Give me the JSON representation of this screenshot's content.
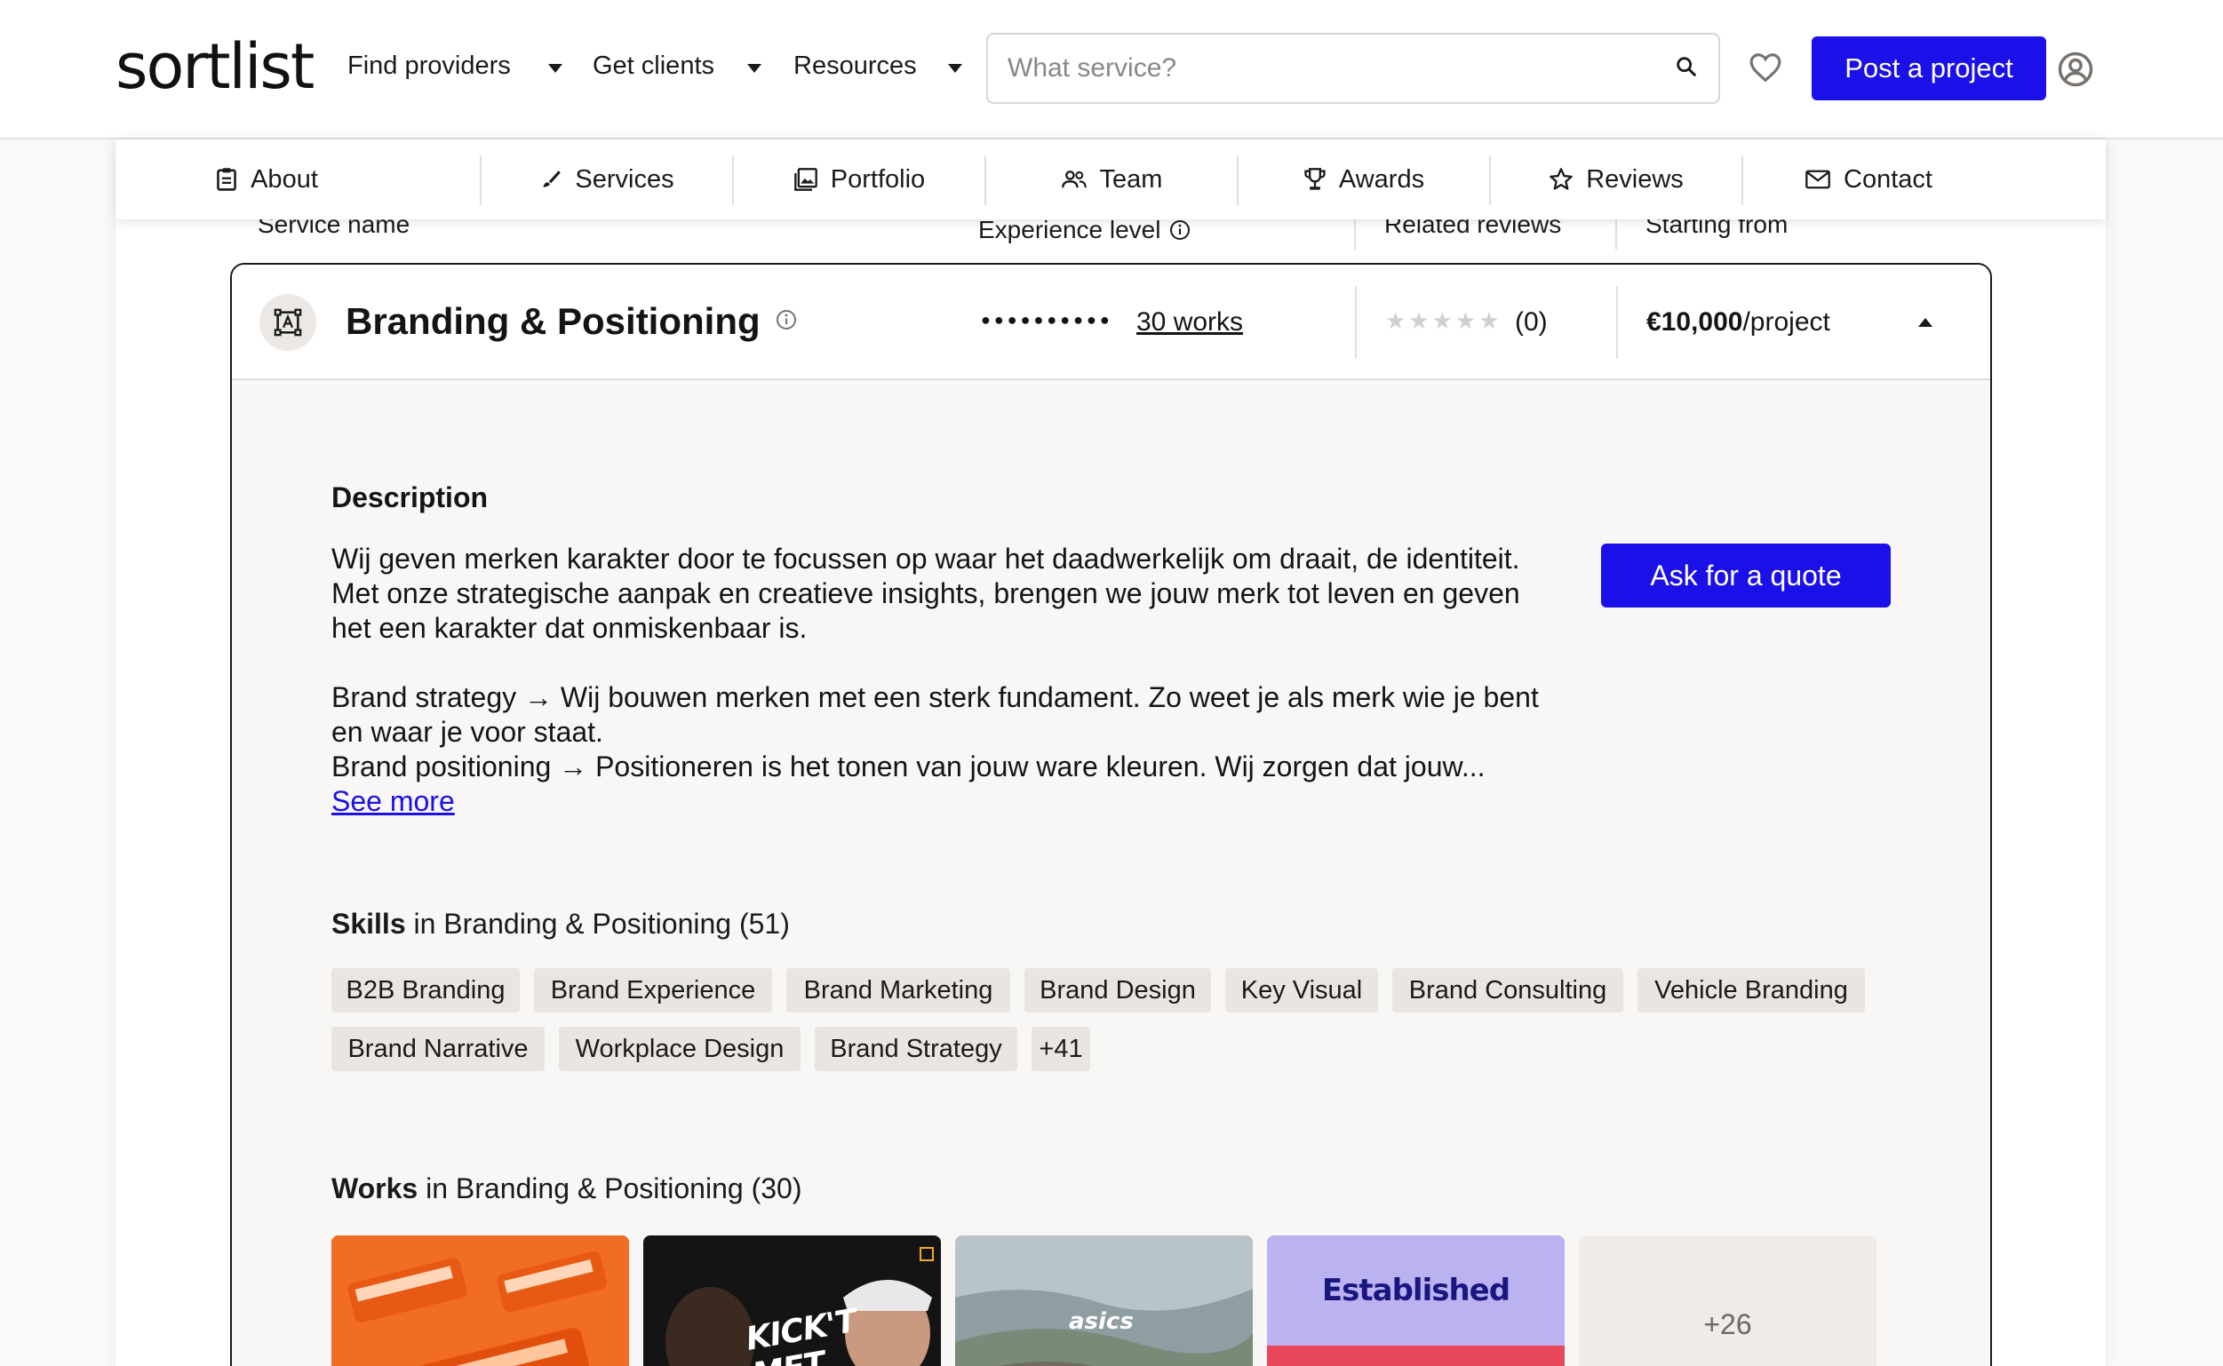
{
  "header": {
    "logo": "sortlist",
    "nav": [
      {
        "label": "Find providers"
      },
      {
        "label": "Get clients"
      },
      {
        "label": "Resources"
      }
    ],
    "search_placeholder": "What service?",
    "post_project_label": "Post a project"
  },
  "subnav": {
    "items": [
      {
        "label": "About",
        "icon": "clipboard-icon"
      },
      {
        "label": "Services",
        "icon": "brush-icon"
      },
      {
        "label": "Portfolio",
        "icon": "images-icon"
      },
      {
        "label": "Team",
        "icon": "people-icon"
      },
      {
        "label": "Awards",
        "icon": "trophy-icon"
      },
      {
        "label": "Reviews",
        "icon": "star-icon"
      },
      {
        "label": "Contact",
        "icon": "mail-icon"
      }
    ]
  },
  "table_header": {
    "service_name": "Service name",
    "experience_level": "Experience level",
    "related_reviews": "Related reviews",
    "starting_from": "Starting from"
  },
  "service": {
    "title": "Branding & Positioning",
    "experience_dots": "●●●●●●●●●●",
    "works_link": "30 works",
    "stars": "★★★★★",
    "review_count": "(0)",
    "price_amount": "€10,000",
    "price_unit": "/project",
    "description_heading": "Description",
    "description_p1": "Wij geven merken karakter door te focussen op waar het daadwerkelijk om draait, de identiteit. Met onze strategische aanpak en creatieve insights, brengen we jouw merk tot leven en geven het een karakter dat onmiskenbaar is.",
    "description_p2": "Brand strategy → Wij bouwen merken met een sterk fundament. Zo weet je als merk wie je bent en waar je voor staat.",
    "description_p3": "Brand positioning → Positioneren is het tonen van jouw ware kleuren. Wij zorgen dat jouw...",
    "see_more": "See more",
    "quote_button": "Ask for a quote",
    "skills_heading_bold": "Skills",
    "skills_heading_rest": " in Branding & Positioning (51)",
    "skills": [
      "B2B Branding",
      "Brand Experience",
      "Brand Marketing",
      "Brand Design",
      "Key Visual",
      "Brand Consulting",
      "Vehicle Branding",
      "Brand Narrative",
      "Workplace Design",
      "Brand Strategy",
      "+41"
    ],
    "works_heading_bold": "Works",
    "works_heading_rest": " in Branding & Positioning (30)",
    "works_thumbs": [
      {
        "label": "",
        "caption": ""
      },
      {
        "label": "KICK'T MET",
        "caption": ""
      },
      {
        "label": "asics",
        "caption": ""
      },
      {
        "label": "Established",
        "caption": ""
      },
      {
        "label": "+26",
        "caption": ""
      }
    ]
  },
  "colors": {
    "brand_blue": "#1c10e8",
    "tag_bg": "#e9e5e1",
    "panel_bg": "#f8f7f5"
  }
}
